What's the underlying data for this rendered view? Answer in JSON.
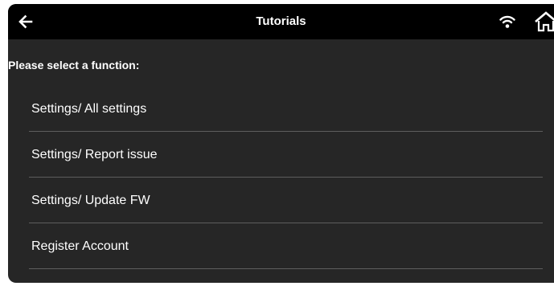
{
  "header": {
    "title": "Tutorials",
    "back_icon": "back-arrow-icon",
    "wifi_icon": "wifi-icon",
    "home_icon": "home-icon"
  },
  "prompt": "Please select a function:",
  "menu": {
    "items": [
      {
        "label": "Settings/ All settings"
      },
      {
        "label": "Settings/ Report issue"
      },
      {
        "label": "Settings/ Update FW"
      },
      {
        "label": "Register Account"
      }
    ]
  },
  "colors": {
    "background": "#262626",
    "header_background": "#000000",
    "text": "#ffffff",
    "divider": "#5e5e5e"
  }
}
